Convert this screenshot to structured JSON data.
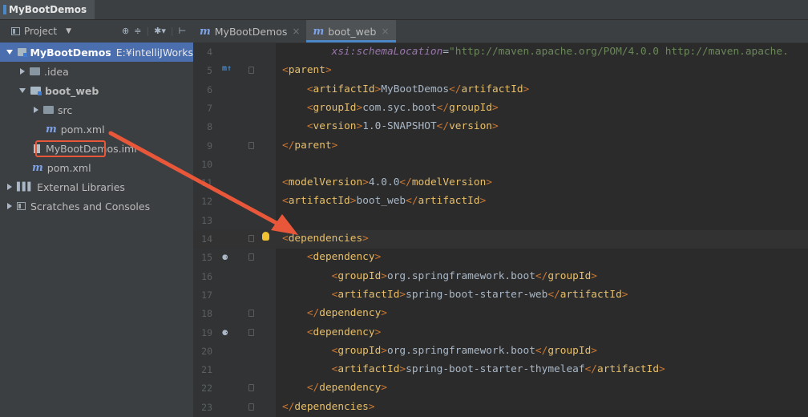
{
  "breadcrumb": {
    "label": "MyBootDemos"
  },
  "project_panel": {
    "header_label": "Project",
    "items": [
      {
        "label": "MyBootDemos",
        "suffix": "E:¥intelliJWorks¥",
        "indent": 0,
        "type": "module",
        "expanded": true,
        "selected": true
      },
      {
        "label": ".idea",
        "indent": 1,
        "type": "folder",
        "expanded": false
      },
      {
        "label": "boot_web",
        "indent": 1,
        "type": "module",
        "expanded": true
      },
      {
        "label": "src",
        "indent": 2,
        "type": "folder",
        "expanded": false
      },
      {
        "label": "pom.xml",
        "indent": 2,
        "type": "maven",
        "highlighted": true
      },
      {
        "label": "MyBootDemos.iml",
        "indent": 1,
        "type": "iml"
      },
      {
        "label": "pom.xml",
        "indent": 1,
        "type": "maven"
      },
      {
        "label": "External Libraries",
        "indent": 0,
        "type": "libraries",
        "expanded": false
      },
      {
        "label": "Scratches and Consoles",
        "indent": 0,
        "type": "scratches",
        "expanded": false
      }
    ]
  },
  "editor_tabs": [
    {
      "label": "MyBootDemos",
      "active": false
    },
    {
      "label": "boot_web",
      "active": true
    }
  ],
  "editor": {
    "lines": [
      {
        "n": "4",
        "text": "        xsi:schemaLocation=\"http://maven.apache.org/POM/4.0.0 http://maven.apache."
      },
      {
        "n": "5",
        "text": "<parent>"
      },
      {
        "n": "6",
        "text": "    <artifactId>MyBootDemos</artifactId>"
      },
      {
        "n": "7",
        "text": "    <groupId>com.syc.boot</groupId>"
      },
      {
        "n": "8",
        "text": "    <version>1.0-SNAPSHOT</version>"
      },
      {
        "n": "9",
        "text": "</parent>"
      },
      {
        "n": "10",
        "text": ""
      },
      {
        "n": "11",
        "text": "<modelVersion>4.0.0</modelVersion>"
      },
      {
        "n": "12",
        "text": "<artifactId>boot_web</artifactId>"
      },
      {
        "n": "13",
        "text": ""
      },
      {
        "n": "14",
        "text": "<dependencies>"
      },
      {
        "n": "15",
        "text": "    <dependency>"
      },
      {
        "n": "16",
        "text": "        <groupId>org.springframework.boot</groupId>"
      },
      {
        "n": "17",
        "text": "        <artifactId>spring-boot-starter-web</artifactId>"
      },
      {
        "n": "18",
        "text": "    </dependency>"
      },
      {
        "n": "19",
        "text": "    <dependency>"
      },
      {
        "n": "20",
        "text": "        <groupId>org.springframework.boot</groupId>"
      },
      {
        "n": "21",
        "text": "        <artifactId>spring-boot-starter-thymeleaf</artifactId>"
      },
      {
        "n": "22",
        "text": "    </dependency>"
      },
      {
        "n": "23",
        "text": "</dependencies>"
      }
    ]
  },
  "colors": {
    "accent": "#4a88c7",
    "annotation_arrow": "#e8573a",
    "selection": "#4b6eaf"
  }
}
